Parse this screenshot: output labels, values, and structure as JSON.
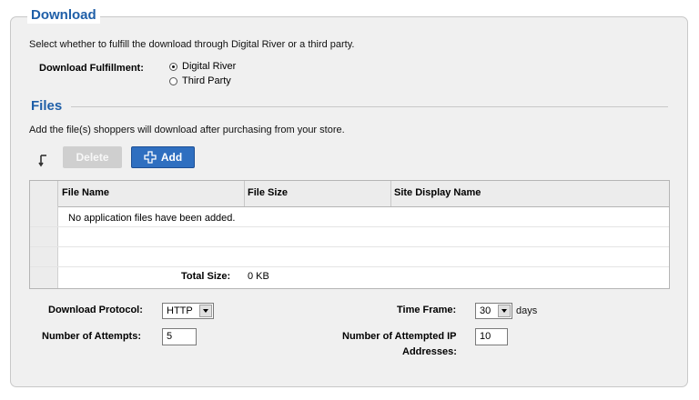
{
  "download": {
    "title": "Download",
    "description": "Select whether to fulfill the download through Digital River or a third party.",
    "fulfillment_label": "Download Fulfillment:",
    "options": [
      {
        "label": "Digital River",
        "checked": true
      },
      {
        "label": "Third Party",
        "checked": false
      }
    ]
  },
  "files": {
    "title": "Files",
    "description": "Add the file(s) shoppers will download after purchasing from your store.",
    "delete_label": "Delete",
    "add_label": "Add",
    "columns": [
      "File Name",
      "File Size",
      "Site Display Name"
    ],
    "empty_message": "No application files have been added.",
    "total_label": "Total Size:",
    "total_value": "0 KB"
  },
  "settings": {
    "protocol_label": "Download Protocol:",
    "protocol_value": "HTTP",
    "attempts_label": "Number of Attempts:",
    "attempts_value": "5",
    "timeframe_label": "Time Frame:",
    "timeframe_value": "30",
    "timeframe_unit": "days",
    "ip_label_line1": "Number of Attempted IP",
    "ip_label_line2": "Addresses:",
    "ip_value": "10"
  },
  "colors": {
    "heading": "#1f5fa8",
    "add_button": "#2f6fc0",
    "panel_bg": "#f0f0f0"
  }
}
